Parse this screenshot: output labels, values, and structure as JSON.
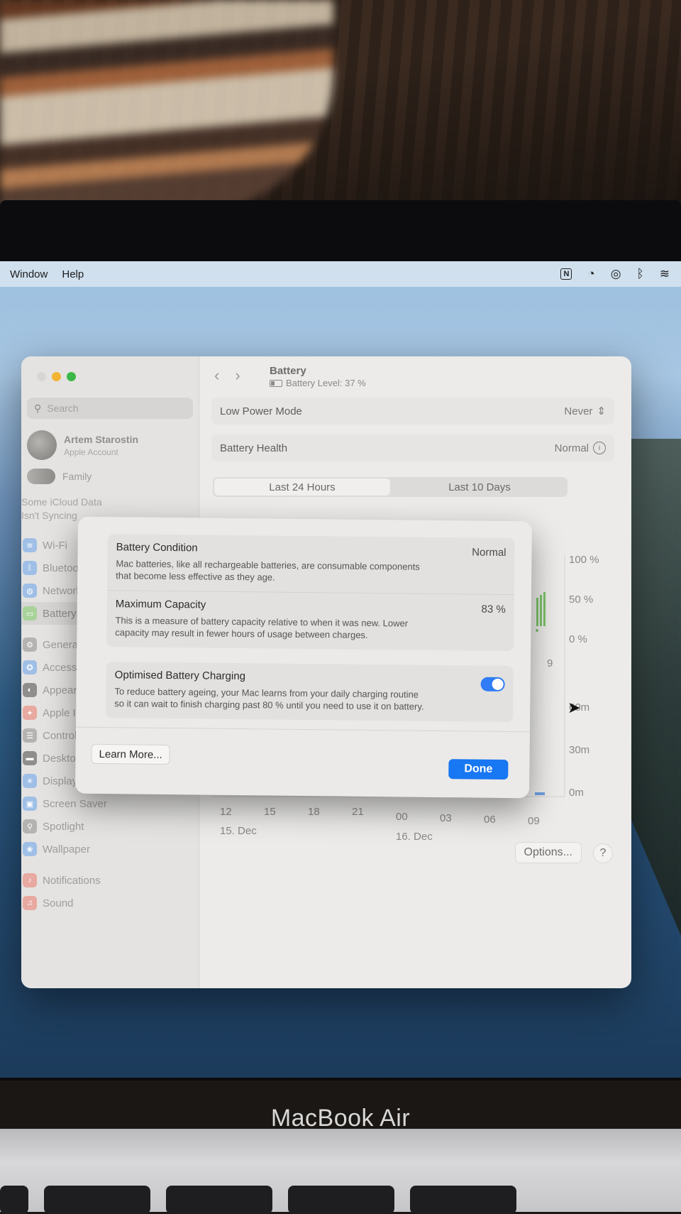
{
  "menubar": {
    "items": [
      "Window",
      "Help"
    ],
    "status_icons": [
      "notion-icon",
      "speedometer-icon",
      "airdrop-icon",
      "bluetooth-icon",
      "wifi-icon"
    ]
  },
  "sidebar": {
    "search_placeholder": "Search",
    "user_name": "Artem Starostin",
    "user_sub": "Apple Account",
    "family": "Family",
    "icloud_line1": "Some iCloud Data",
    "icloud_line2": "Isn't Syncing",
    "items": [
      {
        "label": "Wi-Fi",
        "icon": "wifi-icon"
      },
      {
        "label": "Bluetooth",
        "icon": "bluetooth-icon"
      },
      {
        "label": "Network",
        "icon": "globe-icon"
      },
      {
        "label": "Battery",
        "icon": "battery-icon",
        "selected": true
      },
      {
        "label": "General",
        "icon": "gear-icon"
      },
      {
        "label": "Accessibili",
        "icon": "accessibility-icon"
      },
      {
        "label": "Appearanc",
        "icon": "appearance-icon"
      },
      {
        "label": "Apple Intel",
        "icon": "apple-intelligence-icon"
      },
      {
        "label": "Control Ce",
        "icon": "control-center-icon"
      },
      {
        "label": "Desktop & Dock",
        "icon": "dock-icon"
      },
      {
        "label": "Displays",
        "icon": "display-icon"
      },
      {
        "label": "Screen Saver",
        "icon": "screen-saver-icon"
      },
      {
        "label": "Spotlight",
        "icon": "spotlight-icon"
      },
      {
        "label": "Wallpaper",
        "icon": "wallpaper-icon"
      },
      {
        "label": "Notifications",
        "icon": "bell-icon"
      },
      {
        "label": "Sound",
        "icon": "speaker-icon"
      }
    ]
  },
  "main": {
    "title": "Battery",
    "battery_level": "Battery Level: 37 %",
    "low_power_label": "Low Power Mode",
    "low_power_value": "Never",
    "health_label": "Battery Health",
    "health_value": "Normal",
    "tabs": [
      "Last 24 Hours",
      "Last 10 Days"
    ],
    "y_percent": [
      "100 %",
      "50 %",
      "0 %"
    ],
    "y_minutes": [
      "60m",
      "30m",
      "0m"
    ],
    "x_ticks": [
      "12",
      "15",
      "18",
      "21",
      "00",
      "03",
      "06",
      "09"
    ],
    "x_partial": "9",
    "day_1": "15. Dec",
    "day_2": "16. Dec",
    "options_label": "Options...",
    "help_label": "?"
  },
  "sheet": {
    "condition_title": "Battery Condition",
    "condition_desc": "Mac batteries, like all rechargeable batteries, are consumable components that become less effective as they age.",
    "condition_value": "Normal",
    "capacity_title": "Maximum Capacity",
    "capacity_desc": "This is a measure of battery capacity relative to when it was new. Lower capacity may result in fewer hours of usage between charges.",
    "capacity_value": "83 %",
    "optimised_title": "Optimised Battery Charging",
    "optimised_desc": "To reduce battery ageing, your Mac learns from your daily charging routine so it can wait to finish charging past 80 % until you need to use it on battery.",
    "optimised_on": true,
    "learn_more": "Learn More...",
    "done": "Done"
  },
  "device": {
    "brand": "MacBook Air"
  }
}
